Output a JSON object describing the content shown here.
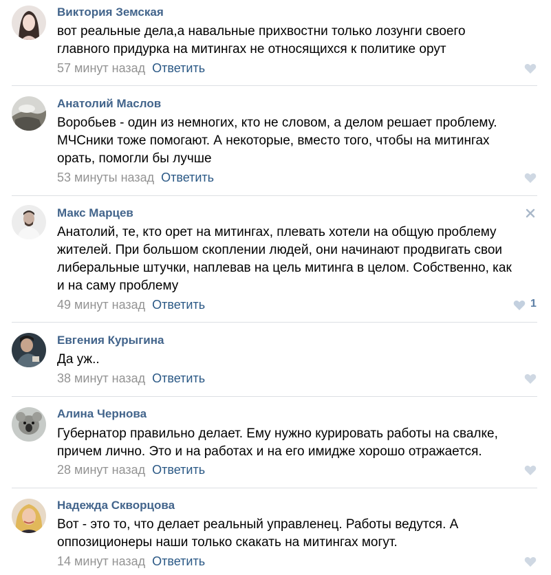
{
  "comments": [
    {
      "author": "Виктория Земская",
      "lines": [
        "вот реальные дела,а навальные прихвостни только лозунги своего",
        "главного придурка на митингах не относящихся к политике орут"
      ],
      "time": "57 минут назад",
      "reply": "Ответить",
      "likes": ""
    },
    {
      "author": "Анатолий Маслов",
      "lines": [
        "Воробьев - один из немногих, кто не словом, а делом решает проблему.",
        "МЧСники тоже помогают. А некоторые, вместо того, чтобы на митингах",
        "орать, помогли бы лучше"
      ],
      "time": "53 минуты назад",
      "reply": "Ответить",
      "likes": ""
    },
    {
      "author": "Макс Марцев",
      "lines": [
        "Анатолий, те, кто орет на митингах, плевать хотели на общую проблему",
        "жителей. При большом скоплении людей, они начинают продвигать свои",
        "либеральные штучки, наплевав на цель митинга в целом. Собственно, как",
        "и на саму проблему"
      ],
      "time": "49 минут назад",
      "reply": "Ответить",
      "likes": "1"
    },
    {
      "author": "Евгения Курыгина",
      "lines": [
        "Да уж.."
      ],
      "time": "38 минут назад",
      "reply": "Ответить",
      "likes": ""
    },
    {
      "author": "Алина Чернова",
      "lines": [
        "Губернатор правильно делает. Ему нужно курировать работы на свалке,",
        "причем лично. Это и на работах и на его имидже хорошо отражается."
      ],
      "time": "28 минут назад",
      "reply": "Ответить",
      "likes": ""
    },
    {
      "author": "Надежда Скворцова",
      "lines": [
        "Вот - это то, что делает реальный управленец. Работы ведутся. А",
        "оппозиционеры наши только скакать на митингах могут."
      ],
      "time": "14 минут назад",
      "reply": "Ответить",
      "likes": ""
    }
  ],
  "colors": {
    "author": "#42648b",
    "link": "#2a5885",
    "meta": "#939393",
    "like": "#cfd8e3",
    "like_active": "#c3d0df",
    "divider": "#dcdfe3"
  },
  "icons": {
    "like": "heart-icon",
    "close": "close-icon"
  }
}
